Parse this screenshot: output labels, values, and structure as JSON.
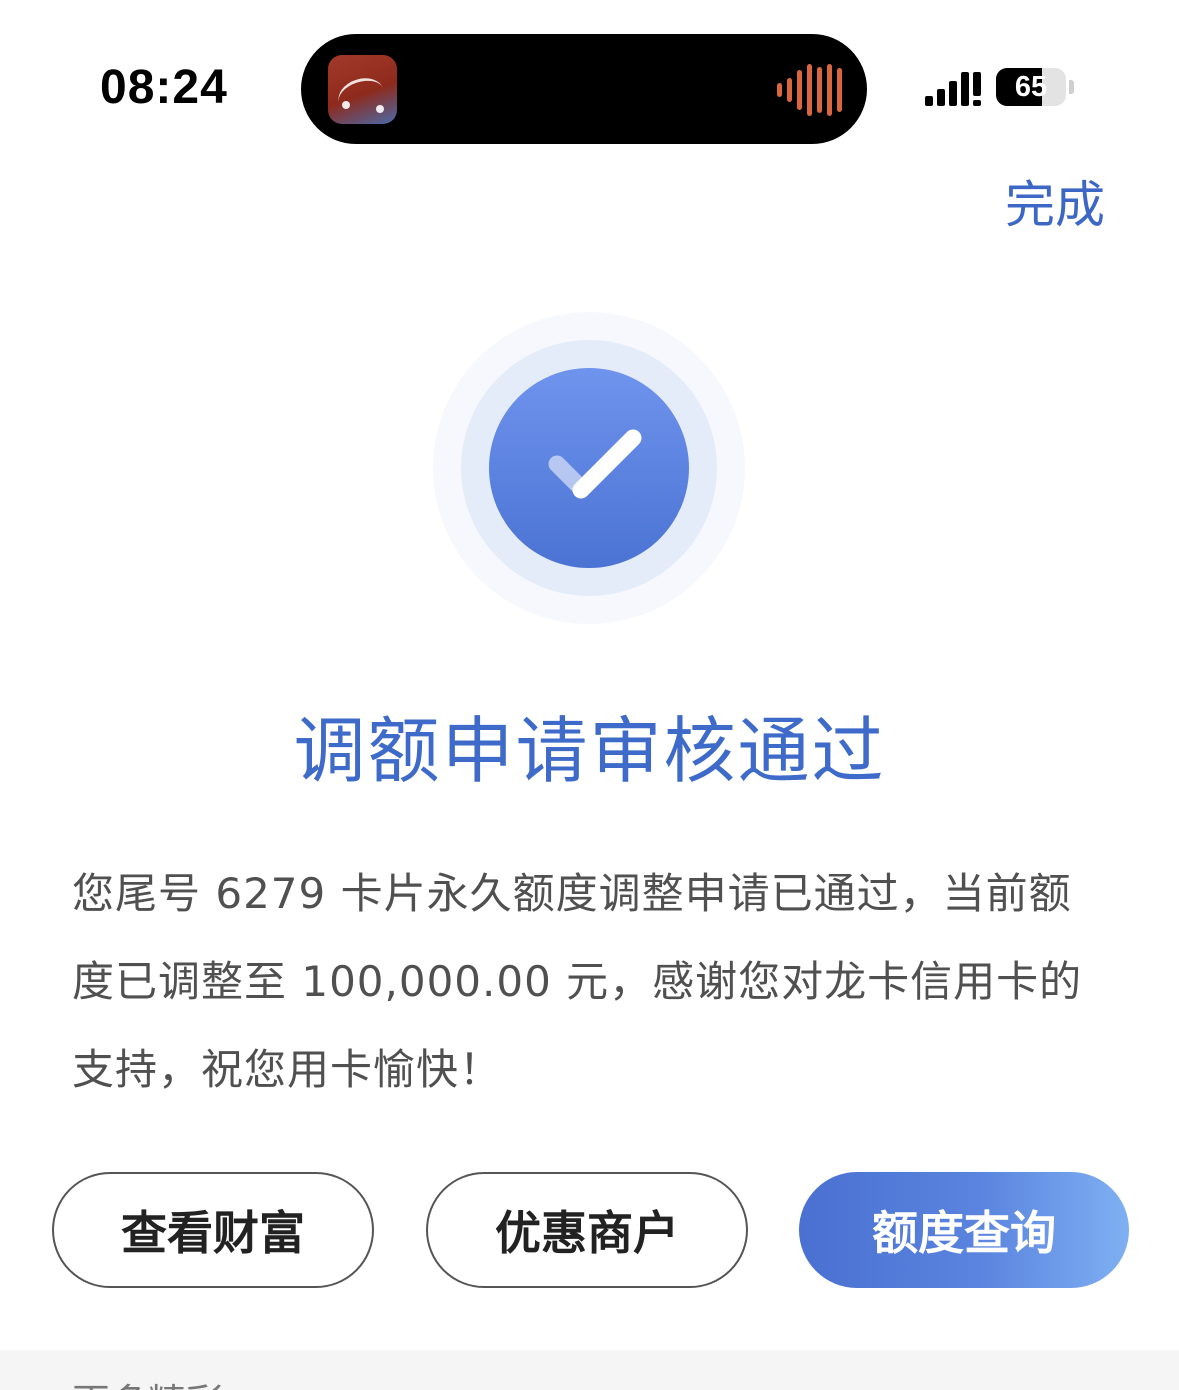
{
  "status_bar": {
    "time": "08:24",
    "battery_percent": "65",
    "battery_level": 0.65
  },
  "nav": {
    "done_label": "完成"
  },
  "result": {
    "title": "调额申请审核通过",
    "message": "您尾号 6279 卡片永久额度调整申请已通过，当前额度已调整至 100,000.00 元，感谢您对龙卡信用卡的支持，祝您用卡愉快！"
  },
  "actions": {
    "view_wealth": "查看财富",
    "merchants": "优惠商户",
    "credit_query": "额度查询"
  },
  "more": {
    "label": "更多精彩"
  },
  "colors": {
    "accent": "#3e6bc9",
    "check_circle": "#5a80de",
    "primary_button_start": "#4a70d1",
    "primary_button_end": "#7fb0f2",
    "island_wave": "#d9663f"
  },
  "icons": {
    "status": [
      "signal-icon",
      "battery-icon"
    ],
    "island": [
      "music-app-icon",
      "audio-waveform-icon"
    ],
    "result": "success-check-icon"
  }
}
